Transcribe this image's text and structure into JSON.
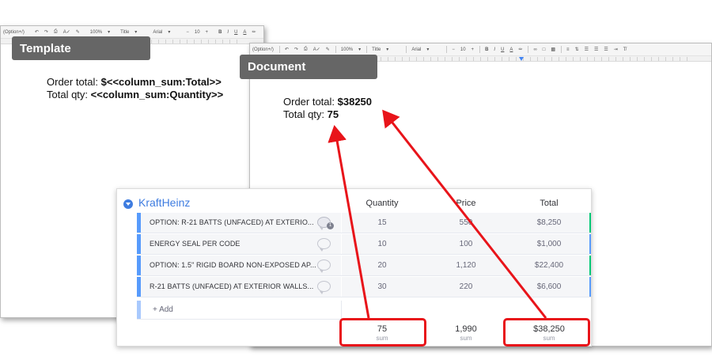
{
  "template_window": {
    "toolbar": {
      "mode": "(Option+/)",
      "zoom": "100%",
      "style": "Title",
      "font": "Arial",
      "font_size": "10",
      "bold": "B",
      "italic": "I",
      "underline": "U",
      "text_color": "A",
      "ruler_numbers": [
        "1",
        "2",
        "3",
        "4",
        "5",
        "6",
        "7",
        "8",
        "9",
        "10",
        "11"
      ]
    },
    "badge": "Template",
    "lines": [
      {
        "label": "Order total: ",
        "value": "$<<column_sum:Total>>"
      },
      {
        "label": "Total qty: ",
        "value": "<<column_sum:Quantity>>"
      }
    ]
  },
  "document_window": {
    "toolbar": {
      "mode": "(Option+/)",
      "zoom": "100%",
      "style": "Title",
      "font": "Arial",
      "font_size": "10",
      "bold": "B",
      "italic": "I",
      "underline": "U",
      "text_color": "A",
      "ruler_numbers": [
        "1",
        "2",
        "3",
        "4",
        "5",
        "6",
        "7",
        "8",
        "9",
        "10",
        "11"
      ]
    },
    "badge": "Document",
    "lines": [
      {
        "label": "Order total: ",
        "value": "$38250"
      },
      {
        "label": "Total qty: ",
        "value": "75"
      }
    ]
  },
  "board": {
    "group_name": "KraftHeinz",
    "group_color": "#3e7ce0",
    "columns": [
      "Quantity",
      "Price",
      "Total"
    ],
    "rows": [
      {
        "name": "OPTION: R-21 BATTS (UNFACED) AT EXTERIO...",
        "comments": "1",
        "quantity": "15",
        "price": "550",
        "total": "$8,250",
        "end_color": "#00c875"
      },
      {
        "name": "ENERGY SEAL PER CODE",
        "comments": "",
        "quantity": "10",
        "price": "100",
        "total": "$1,000",
        "end_color": "#579bfc"
      },
      {
        "name": "OPTION: 1.5\" RIGID BOARD NON-EXPOSED AP...",
        "comments": "",
        "quantity": "20",
        "price": "1,120",
        "total": "$22,400",
        "end_color": "#00c875"
      },
      {
        "name": "R-21 BATTS (UNFACED) AT EXTERIOR WALLS...",
        "comments": "",
        "quantity": "30",
        "price": "220",
        "total": "$6,600",
        "end_color": "#579bfc"
      }
    ],
    "add_label": "+ Add",
    "sums": [
      {
        "value": "75",
        "label": "sum"
      },
      {
        "value": "1,990",
        "label": "sum"
      },
      {
        "value": "$38,250",
        "label": "sum"
      }
    ]
  },
  "annotation_color": "#e8141a"
}
